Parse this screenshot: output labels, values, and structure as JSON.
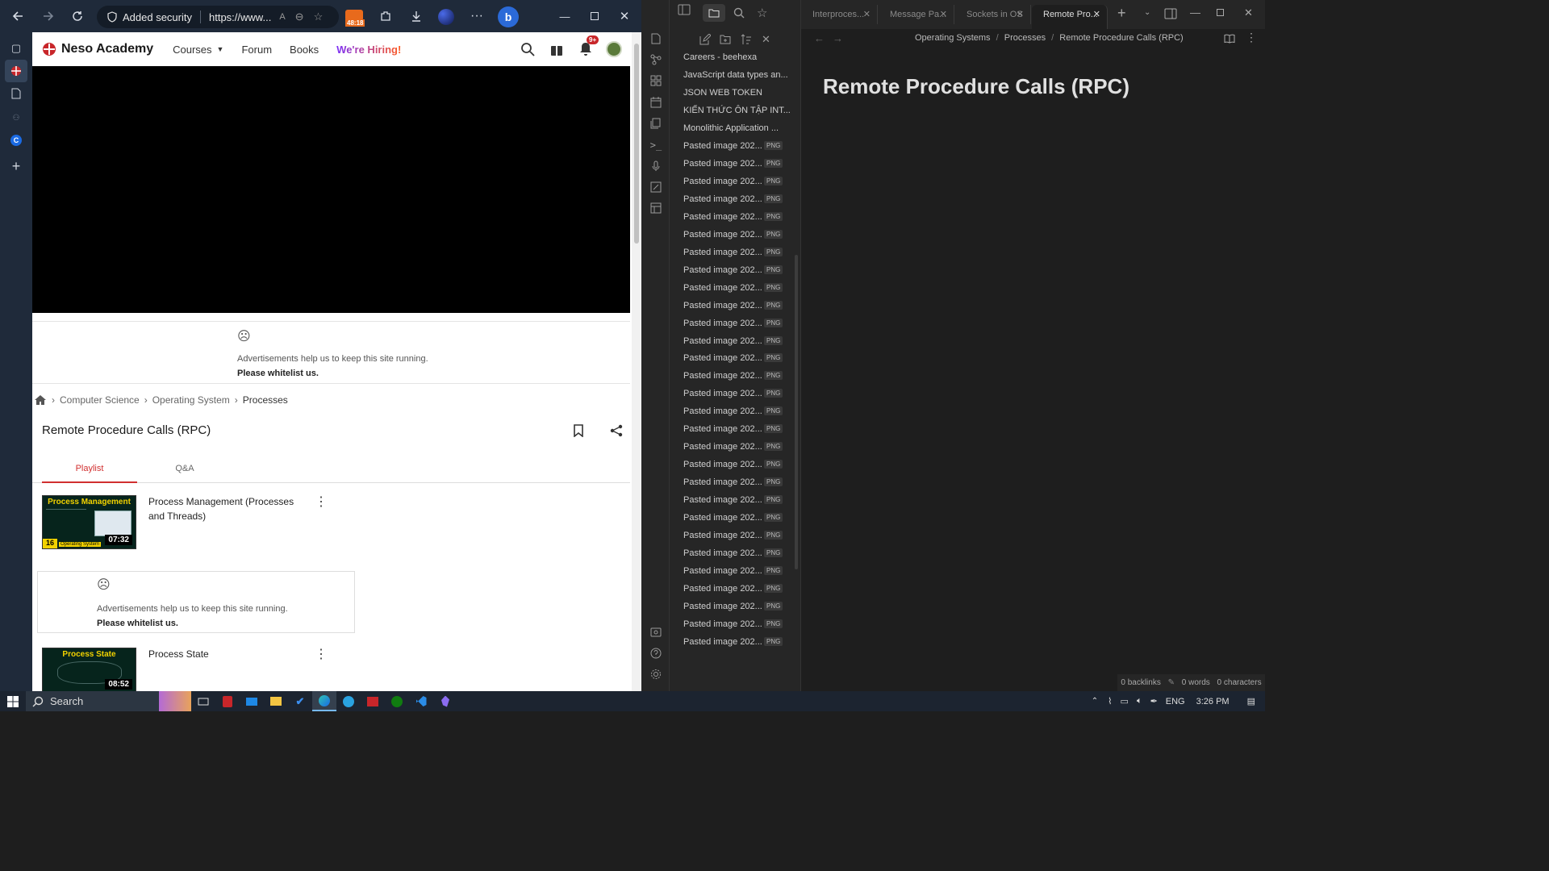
{
  "browser": {
    "security_label": "Added security",
    "url": "https://www...",
    "timer_badge": "48:18"
  },
  "neso": {
    "brand": "Neso Academy",
    "nav": [
      "Courses",
      "Forum",
      "Books",
      "We're Hiring!"
    ],
    "notif_badge": "9+",
    "ad_line1": "Advertisements help us to keep this site running.",
    "ad_line2": "Please whitelist us.",
    "breadcrumb": [
      "Computer Science",
      "Operating System",
      "Processes"
    ],
    "page_title": "Remote Procedure Calls (RPC)",
    "tabs": [
      "Playlist",
      "Q&A"
    ],
    "playlist": [
      {
        "title": "Process Management (Processes and Threads)",
        "thumb_title": "Process Management",
        "duration": "07:32",
        "thumb_num": "16",
        "thumb_tag": "Operating System"
      },
      {
        "title": "Process State",
        "thumb_title": "Process State",
        "duration": "08:52"
      }
    ]
  },
  "obsidian": {
    "tabs": [
      "Interproces...",
      "Message Pa...",
      "Sockets in OS",
      "Remote Pro..."
    ],
    "breadcrumb": [
      "Operating Systems",
      "Processes",
      "Remote Procedure Calls (RPC)"
    ],
    "note_title": "Remote Procedure Calls (RPC)",
    "files": [
      {
        "name": "Careers - beehexa",
        "badge": ""
      },
      {
        "name": "JavaScript data types an...",
        "badge": ""
      },
      {
        "name": "JSON WEB TOKEN",
        "badge": ""
      },
      {
        "name": "KIẾN THỨC ÔN TẬP INT...",
        "badge": ""
      },
      {
        "name": "Monolithic Application ...",
        "badge": ""
      },
      {
        "name": "Pasted image 202...",
        "badge": "PNG"
      },
      {
        "name": "Pasted image 202...",
        "badge": "PNG"
      },
      {
        "name": "Pasted image 202...",
        "badge": "PNG"
      },
      {
        "name": "Pasted image 202...",
        "badge": "PNG"
      },
      {
        "name": "Pasted image 202...",
        "badge": "PNG"
      },
      {
        "name": "Pasted image 202...",
        "badge": "PNG"
      },
      {
        "name": "Pasted image 202...",
        "badge": "PNG"
      },
      {
        "name": "Pasted image 202...",
        "badge": "PNG"
      },
      {
        "name": "Pasted image 202...",
        "badge": "PNG"
      },
      {
        "name": "Pasted image 202...",
        "badge": "PNG"
      },
      {
        "name": "Pasted image 202...",
        "badge": "PNG"
      },
      {
        "name": "Pasted image 202...",
        "badge": "PNG"
      },
      {
        "name": "Pasted image 202...",
        "badge": "PNG"
      },
      {
        "name": "Pasted image 202...",
        "badge": "PNG"
      },
      {
        "name": "Pasted image 202...",
        "badge": "PNG"
      },
      {
        "name": "Pasted image 202...",
        "badge": "PNG"
      },
      {
        "name": "Pasted image 202...",
        "badge": "PNG"
      },
      {
        "name": "Pasted image 202...",
        "badge": "PNG"
      },
      {
        "name": "Pasted image 202...",
        "badge": "PNG"
      },
      {
        "name": "Pasted image 202...",
        "badge": "PNG"
      },
      {
        "name": "Pasted image 202...",
        "badge": "PNG"
      },
      {
        "name": "Pasted image 202...",
        "badge": "PNG"
      },
      {
        "name": "Pasted image 202...",
        "badge": "PNG"
      },
      {
        "name": "Pasted image 202...",
        "badge": "PNG"
      },
      {
        "name": "Pasted image 202...",
        "badge": "PNG"
      },
      {
        "name": "Pasted image 202...",
        "badge": "PNG"
      },
      {
        "name": "Pasted image 202...",
        "badge": "PNG"
      },
      {
        "name": "Pasted image 202...",
        "badge": "PNG"
      },
      {
        "name": "Pasted image 202...",
        "badge": "PNG"
      }
    ],
    "status": {
      "backlinks": "0 backlinks",
      "words": "0 words",
      "chars": "0 characters"
    }
  },
  "taskbar": {
    "search": "Search",
    "lang": "ENG",
    "time": "3:26 PM"
  },
  "colors": {
    "brand_red": "#c8262a",
    "hiring_grad": "#7b2ff7",
    "tab_red": "#d12f2f",
    "obs_bg": "#1e1e1e"
  }
}
